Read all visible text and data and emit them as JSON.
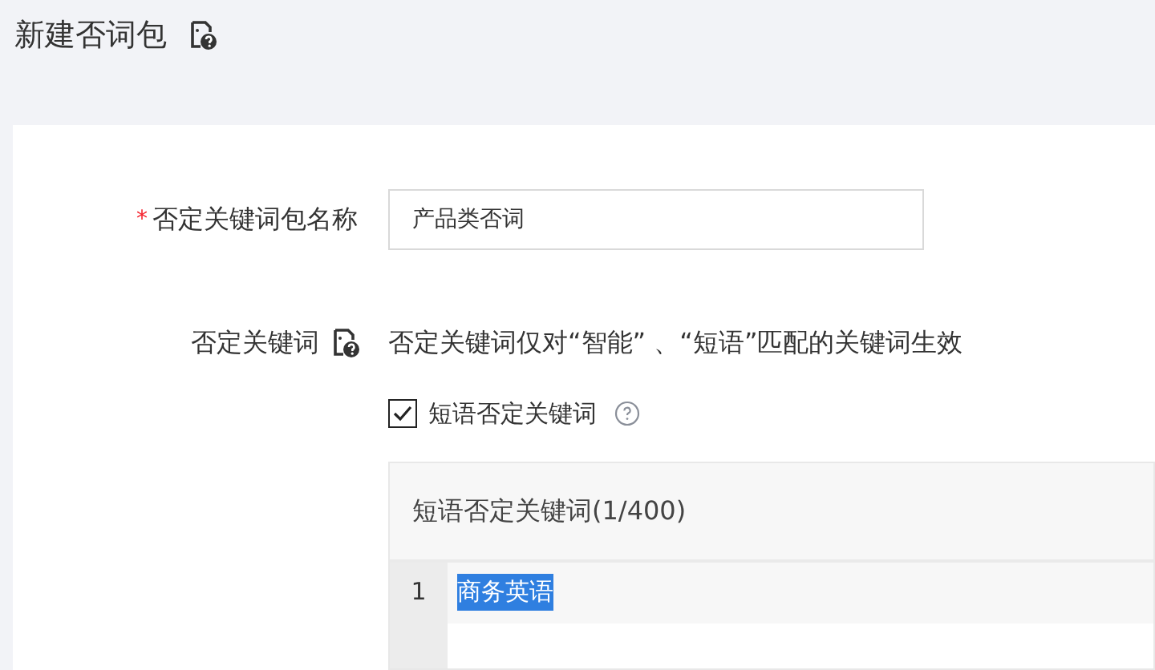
{
  "page": {
    "title": "新建否词包"
  },
  "form": {
    "name_field": {
      "label": "否定关键词包名称",
      "required_mark": "*",
      "value": "产品类否词"
    },
    "keywords_field": {
      "label": "否定关键词",
      "note": "否定关键词仅对“智能” 、“短语”匹配的关键词生效",
      "checkbox": {
        "label": "短语否定关键词",
        "checked": true
      },
      "editor": {
        "header": "短语否定关键词(1/400)",
        "lines": [
          {
            "number": "1",
            "text": "商务英语",
            "selected": true
          }
        ]
      }
    }
  }
}
